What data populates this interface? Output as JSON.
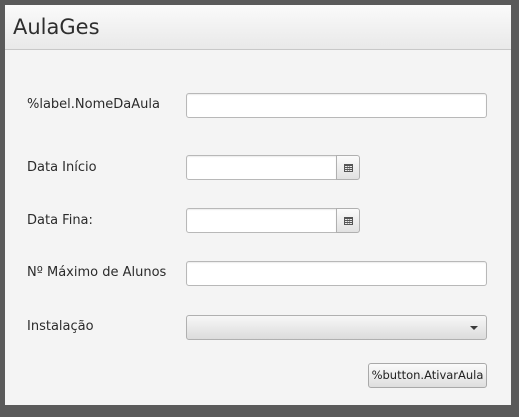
{
  "window": {
    "title": "AulaGes"
  },
  "form": {
    "nome_label": "%label.NomeDaAula",
    "nome_value": "",
    "data_inicio_label": "Data Início",
    "data_inicio_value": "",
    "data_fim_label": "Data Fina:",
    "data_fim_value": "",
    "max_alunos_label": "Nº Máximo de Alunos",
    "max_alunos_value": "",
    "instalacao_label": "Instalação",
    "instalacao_value": "",
    "ativar_button_label": "%button.AtivarAula"
  },
  "icons": {
    "date_picker": "calendar-icon",
    "combo_arrow": "chevron-down-icon"
  }
}
